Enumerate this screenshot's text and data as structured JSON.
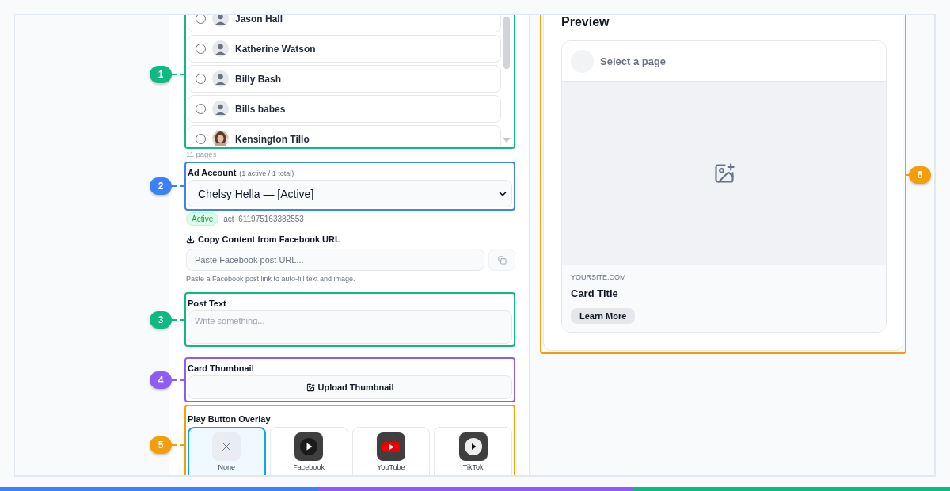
{
  "pages": {
    "annotation": {
      "number": "1",
      "color": "#10b981"
    },
    "items": [
      {
        "name": "Jason Hall",
        "selected": false,
        "kind": "placeholder"
      },
      {
        "name": "Katherine Watson",
        "selected": false,
        "kind": "placeholder"
      },
      {
        "name": "Billy Bash",
        "selected": false,
        "kind": "placeholder"
      },
      {
        "name": "Bills babes",
        "selected": false,
        "kind": "placeholder"
      },
      {
        "name": "Kensington Tillo",
        "selected": false
      }
    ],
    "count": "11 pages"
  },
  "ad_account": {
    "annotation": {
      "number": "2",
      "color": "#3b82f6"
    },
    "label": "Ad Account",
    "summary": "(1 active / 1 total)",
    "value": "Chelsy Hella — [Active]",
    "status": "Active",
    "account_id": "act_611975163382553"
  },
  "copy_content": {
    "label": "Copy Content from Facebook URL",
    "placeholder": "Paste Facebook post URL...",
    "help": "Paste a Facebook post link to auto-fill text and image."
  },
  "post_text": {
    "annotation": {
      "number": "3",
      "color": "#10b981"
    },
    "label": "Post Text",
    "placeholder": "Write something..."
  },
  "card_thumbnail": {
    "annotation": {
      "number": "4",
      "color": "#8b5cf6"
    },
    "label": "Card Thumbnail",
    "button": "Upload Thumbnail"
  },
  "play_overlay": {
    "annotation": {
      "number": "5",
      "color": "#f59e0b"
    },
    "label": "Play Button Overlay",
    "options": [
      {
        "kind": "none",
        "label": "None",
        "selected": true
      },
      {
        "kind": "facebook",
        "label": "Facebook",
        "selected": false
      },
      {
        "kind": "youtube",
        "label": "YouTube",
        "selected": false
      },
      {
        "kind": "tiktok",
        "label": "TikTok",
        "selected": false
      }
    ]
  },
  "preview": {
    "annotation": {
      "number": "6",
      "color": "#f59e0b"
    },
    "title": "Preview",
    "page": "Select a page",
    "domain": "YOURSITE.COM",
    "card_title": "Card Title",
    "cta": "Learn More"
  }
}
